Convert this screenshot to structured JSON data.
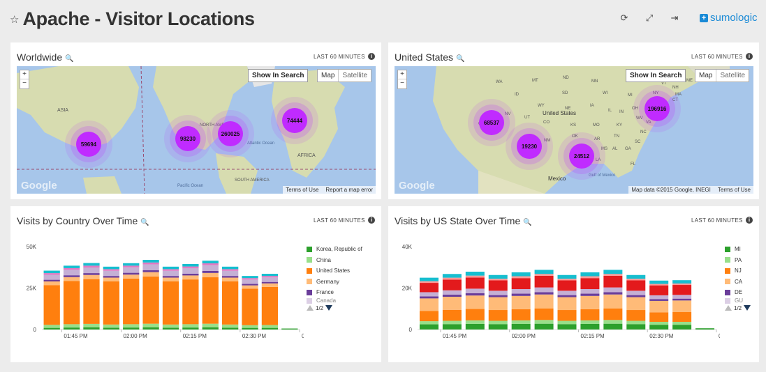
{
  "header": {
    "title": "Apache - Visitor Locations",
    "logo_text": "sumologic",
    "logo_symbol": "+",
    "icons": [
      "star-icon",
      "refresh-icon",
      "expand-icon",
      "exit-icon"
    ]
  },
  "colors": {
    "accent": "#1a8ad6",
    "cluster": "#c02bff"
  },
  "panels": {
    "worldwide": {
      "title": "Worldwide",
      "range": "LAST 60 MINUTES",
      "info": "i",
      "show_in_search": "Show In Search",
      "map_btn": "Map",
      "sat_btn": "Satellite",
      "zoom_in": "+",
      "zoom_out": "−",
      "google": "Google",
      "terms": "Terms of Use",
      "report": "Report a map error",
      "place_labels": [
        "ASIA",
        "NORTH AMERICA",
        "Atlantic Ocean",
        "AFRICA",
        "SOUTH AMERICA",
        "Pacific Ocean"
      ],
      "clusters": [
        {
          "label": "59694"
        },
        {
          "label": "98230"
        },
        {
          "label": "260025"
        },
        {
          "label": "74444"
        }
      ]
    },
    "us": {
      "title": "United States",
      "range": "LAST 60 MINUTES",
      "info": "i",
      "show_in_search": "Show In Search",
      "map_btn": "Map",
      "sat_btn": "Satellite",
      "zoom_in": "+",
      "zoom_out": "−",
      "google": "Google",
      "mapdata": "Map data ©2015 Google, INEGI",
      "terms": "Terms of Use",
      "place_labels": [
        "WA",
        "MT",
        "ND",
        "MN",
        "ID",
        "SD",
        "WI",
        "MI",
        "NY",
        "VT",
        "NH",
        "ME",
        "MA",
        "WY",
        "NE",
        "IA",
        "IL",
        "IN",
        "OH",
        "PA",
        "NV",
        "UT",
        "CO",
        "KS",
        "MO",
        "KY",
        "WV",
        "VA",
        "CA",
        "AZ",
        "NM",
        "OK",
        "AR",
        "TN",
        "NC",
        "SC",
        "MS",
        "AL",
        "GA",
        "TX",
        "LA",
        "FL",
        "United States",
        "Mexico",
        "Gulf of Mexico",
        "CT",
        "NJ",
        "DE",
        "MD"
      ],
      "clusters": [
        {
          "label": "68537"
        },
        {
          "label": "19230"
        },
        {
          "label": "24512"
        },
        {
          "label": "196916"
        }
      ]
    },
    "country_chart": {
      "title": "Visits by Country Over Time",
      "range": "LAST 60 MINUTES",
      "info": "i",
      "legend": [
        {
          "name": "Korea, Republic of",
          "color": "#2ca02c"
        },
        {
          "name": "China",
          "color": "#98df8a"
        },
        {
          "name": "United States",
          "color": "#ff7f0e"
        },
        {
          "name": "Germany",
          "color": "#ffbb78"
        },
        {
          "name": "France",
          "color": "#6a3d9a"
        },
        {
          "name": "Canada",
          "color": "#c5b0d5"
        }
      ],
      "pager": "1/2"
    },
    "state_chart": {
      "title": "Visits by US State Over Time",
      "range": "LAST 60 MINUTES",
      "info": "i",
      "legend": [
        {
          "name": "MI",
          "color": "#2ca02c"
        },
        {
          "name": "PA",
          "color": "#98df8a"
        },
        {
          "name": "NJ",
          "color": "#ff7f0e"
        },
        {
          "name": "CA",
          "color": "#ffbb78"
        },
        {
          "name": "DE",
          "color": "#6a3d9a"
        },
        {
          "name": "GU",
          "color": "#c5b0d5"
        }
      ],
      "pager": "1/2"
    }
  },
  "chart_data": [
    {
      "type": "bar",
      "stacked": true,
      "title": "Visits by Country Over Time",
      "xlabel": "",
      "ylabel": "",
      "ylim": [
        0,
        50000
      ],
      "yticks": [
        "0",
        "25K",
        "50K"
      ],
      "xticks": [
        "01:45 PM",
        "02:00 PM",
        "02:15 PM",
        "02:30 PM",
        "02:45 PM"
      ],
      "categories": [
        "01:40 PM",
        "01:45 PM",
        "01:50 PM",
        "01:55 PM",
        "02:00 PM",
        "02:05 PM",
        "02:10 PM",
        "02:15 PM",
        "02:20 PM",
        "02:25 PM",
        "02:30 PM",
        "02:35 PM",
        "02:40 PM"
      ],
      "grid": false,
      "legend": "right",
      "series": [
        {
          "name": "Korea, Republic of",
          "color": "#2ca02c",
          "values": [
            1000,
            1200,
            1300,
            1100,
            1200,
            1300,
            1100,
            1200,
            1300,
            1100,
            1000,
            1000,
            600
          ]
        },
        {
          "name": "China",
          "color": "#98df8a",
          "values": [
            1800,
            2000,
            2100,
            1900,
            2000,
            2200,
            1900,
            2000,
            2200,
            1900,
            1600,
            1700,
            0
          ]
        },
        {
          "name": "United States",
          "color": "#ff7f0e",
          "values": [
            24000,
            26000,
            27000,
            26000,
            27500,
            28500,
            26000,
            27000,
            28000,
            26000,
            22000,
            23000,
            0
          ]
        },
        {
          "name": "Germany",
          "color": "#ffbb78",
          "values": [
            2200,
            2400,
            2500,
            2300,
            2400,
            2600,
            2300,
            2400,
            2600,
            2300,
            2000,
            2100,
            0
          ]
        },
        {
          "name": "France",
          "color": "#6a3d9a",
          "values": [
            1000,
            1100,
            1100,
            1000,
            1100,
            1200,
            1000,
            1100,
            1200,
            1000,
            900,
            900,
            0
          ]
        },
        {
          "name": "Canada",
          "color": "#c5b0d5",
          "values": [
            3000,
            3300,
            3400,
            3100,
            3300,
            3500,
            3100,
            3300,
            3500,
            3100,
            2600,
            2700,
            0
          ]
        },
        {
          "name": "",
          "color": "#e377c2",
          "values": [
            1000,
            1000,
            1100,
            1000,
            1000,
            1100,
            1000,
            1000,
            1100,
            1000,
            900,
            900,
            0
          ]
        },
        {
          "name": "",
          "color": "#17becf",
          "values": [
            1500,
            1500,
            1600,
            1500,
            1500,
            1600,
            1500,
            1500,
            1600,
            1500,
            1300,
            1300,
            0
          ]
        }
      ]
    },
    {
      "type": "bar",
      "stacked": true,
      "title": "Visits by US State Over Time",
      "xlabel": "",
      "ylabel": "",
      "ylim": [
        0,
        40000
      ],
      "yticks": [
        "0",
        "20K",
        "40K"
      ],
      "xticks": [
        "01:45 PM",
        "02:00 PM",
        "02:15 PM",
        "02:30 PM",
        "02:45 PM"
      ],
      "categories": [
        "01:40 PM",
        "01:45 PM",
        "01:50 PM",
        "01:55 PM",
        "02:00 PM",
        "02:05 PM",
        "02:10 PM",
        "02:15 PM",
        "02:20 PM",
        "02:25 PM",
        "02:30 PM",
        "02:35 PM",
        "02:40 PM"
      ],
      "grid": false,
      "legend": "right",
      "series": [
        {
          "name": "MI",
          "color": "#2ca02c",
          "values": [
            2500,
            2600,
            2700,
            2600,
            2700,
            2800,
            2600,
            2700,
            2800,
            2600,
            2300,
            2300,
            600
          ]
        },
        {
          "name": "PA",
          "color": "#98df8a",
          "values": [
            1500,
            1600,
            1700,
            1600,
            1700,
            1800,
            1600,
            1700,
            1800,
            1600,
            1400,
            1400,
            0
          ]
        },
        {
          "name": "NJ",
          "color": "#ff7f0e",
          "values": [
            5000,
            5300,
            5500,
            5200,
            5400,
            5600,
            5200,
            5400,
            5600,
            5200,
            4600,
            4700,
            0
          ]
        },
        {
          "name": "CA",
          "color": "#ffbb78",
          "values": [
            6000,
            6300,
            6500,
            6200,
            6400,
            6700,
            6200,
            6400,
            6700,
            6200,
            5500,
            5600,
            0
          ]
        },
        {
          "name": "DE",
          "color": "#6a3d9a",
          "values": [
            1000,
            1000,
            1100,
            1000,
            1100,
            1100,
            1000,
            1100,
            1100,
            1000,
            900,
            900,
            0
          ]
        },
        {
          "name": "GU",
          "color": "#c5b0d5",
          "values": [
            2000,
            2100,
            2200,
            2100,
            2200,
            2300,
            2100,
            2200,
            2300,
            2100,
            1800,
            1800,
            0
          ]
        },
        {
          "name": "",
          "color": "#e31a1c",
          "values": [
            4500,
            5200,
            5400,
            5000,
            5300,
            5600,
            5000,
            5300,
            5600,
            5000,
            4800,
            4800,
            0
          ]
        },
        {
          "name": "",
          "color": "#ff9896",
          "values": [
            800,
            900,
            900,
            800,
            900,
            900,
            800,
            900,
            900,
            800,
            700,
            700,
            0
          ]
        },
        {
          "name": "",
          "color": "#17becf",
          "values": [
            1700,
            1800,
            1900,
            1800,
            1900,
            2000,
            1800,
            1900,
            2000,
            1800,
            1600,
            1600,
            0
          ]
        }
      ]
    }
  ]
}
